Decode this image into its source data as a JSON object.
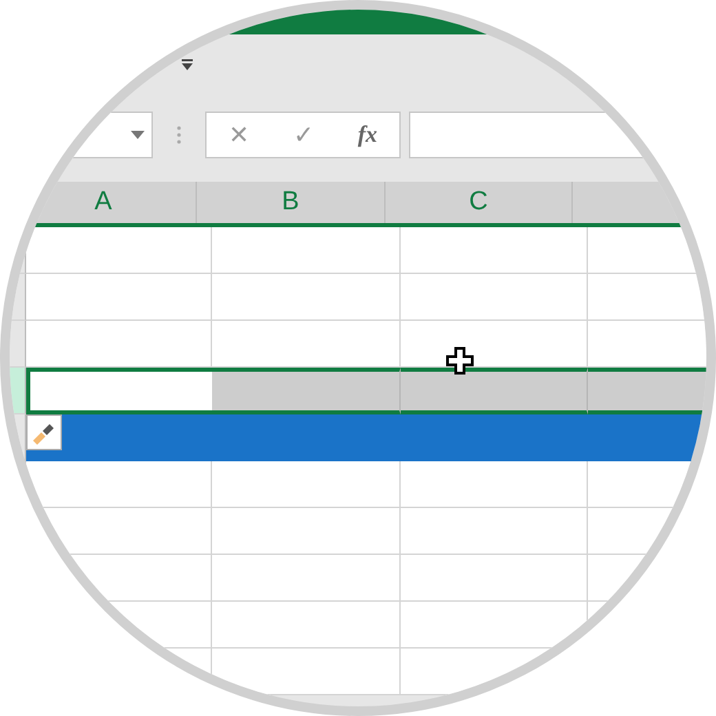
{
  "formula_bar": {
    "cancel": "✕",
    "enter": "✓",
    "function": "fx"
  },
  "columns": [
    {
      "label": "A"
    },
    {
      "label": "B"
    },
    {
      "label": "C"
    },
    {}
  ],
  "rows": [
    {
      "kind": "plain"
    },
    {
      "kind": "plain"
    },
    {
      "kind": "plain"
    },
    {
      "kind": "selected"
    },
    {
      "kind": "filled"
    },
    {
      "kind": "plain"
    },
    {
      "kind": "plain"
    },
    {
      "kind": "plain"
    },
    {
      "kind": "plain"
    },
    {
      "kind": "plain"
    }
  ]
}
